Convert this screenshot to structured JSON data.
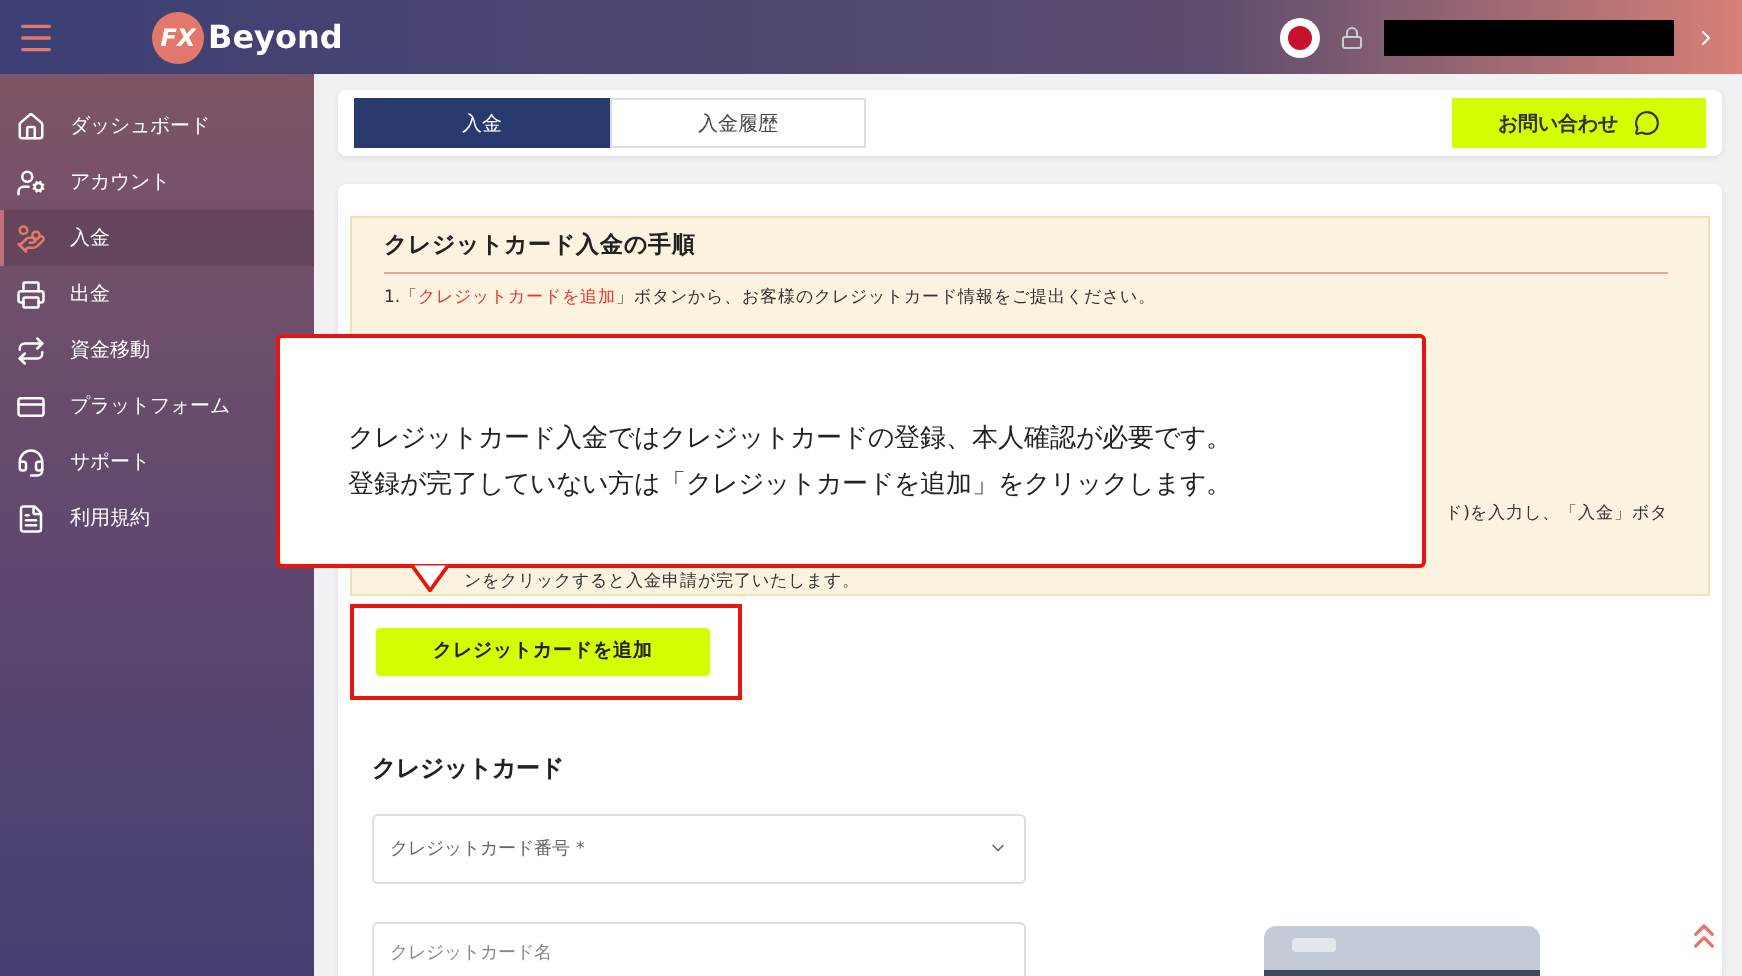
{
  "header": {
    "logo_mark": "FX",
    "logo_text": "Beyond"
  },
  "sidebar": {
    "items": [
      {
        "label": "ダッシュボード",
        "selected": false
      },
      {
        "label": "アカウント",
        "selected": false
      },
      {
        "label": "入金",
        "selected": true
      },
      {
        "label": "出金",
        "selected": false
      },
      {
        "label": "資金移動",
        "selected": false
      },
      {
        "label": "プラットフォーム",
        "selected": false
      },
      {
        "label": "サポート",
        "selected": false
      },
      {
        "label": "利用規約",
        "selected": false
      }
    ]
  },
  "tabs": [
    {
      "label": "入金",
      "selected": true
    },
    {
      "label": "入金履歴",
      "selected": false
    }
  ],
  "contact_button": "お問い合わせ",
  "procedure": {
    "title": "クレジットカード入金の手順",
    "step_1": {
      "number": "1.",
      "open": "「",
      "link": "クレジットカードを追加",
      "close": "」ボタンから、お客様のクレジットカード情報をご提出ください。"
    },
    "step_fragment": "ド)を入力し、「入金」ボタ",
    "last_line": "ンをクリックすると入金申請が完了いたします。"
  },
  "callout": {
    "lines": [
      "クレジットカード入金ではクレジットカードの登録、本人確認が必要です。",
      "登録が完了していない方は「クレジットカードを追加」をクリックします。"
    ]
  },
  "add_card_button": "クレジットカードを追加",
  "credit_card": {
    "title": "クレジットカード",
    "number_placeholder": "クレジットカード番号 *",
    "name_placeholder": "クレジットカード名"
  }
}
